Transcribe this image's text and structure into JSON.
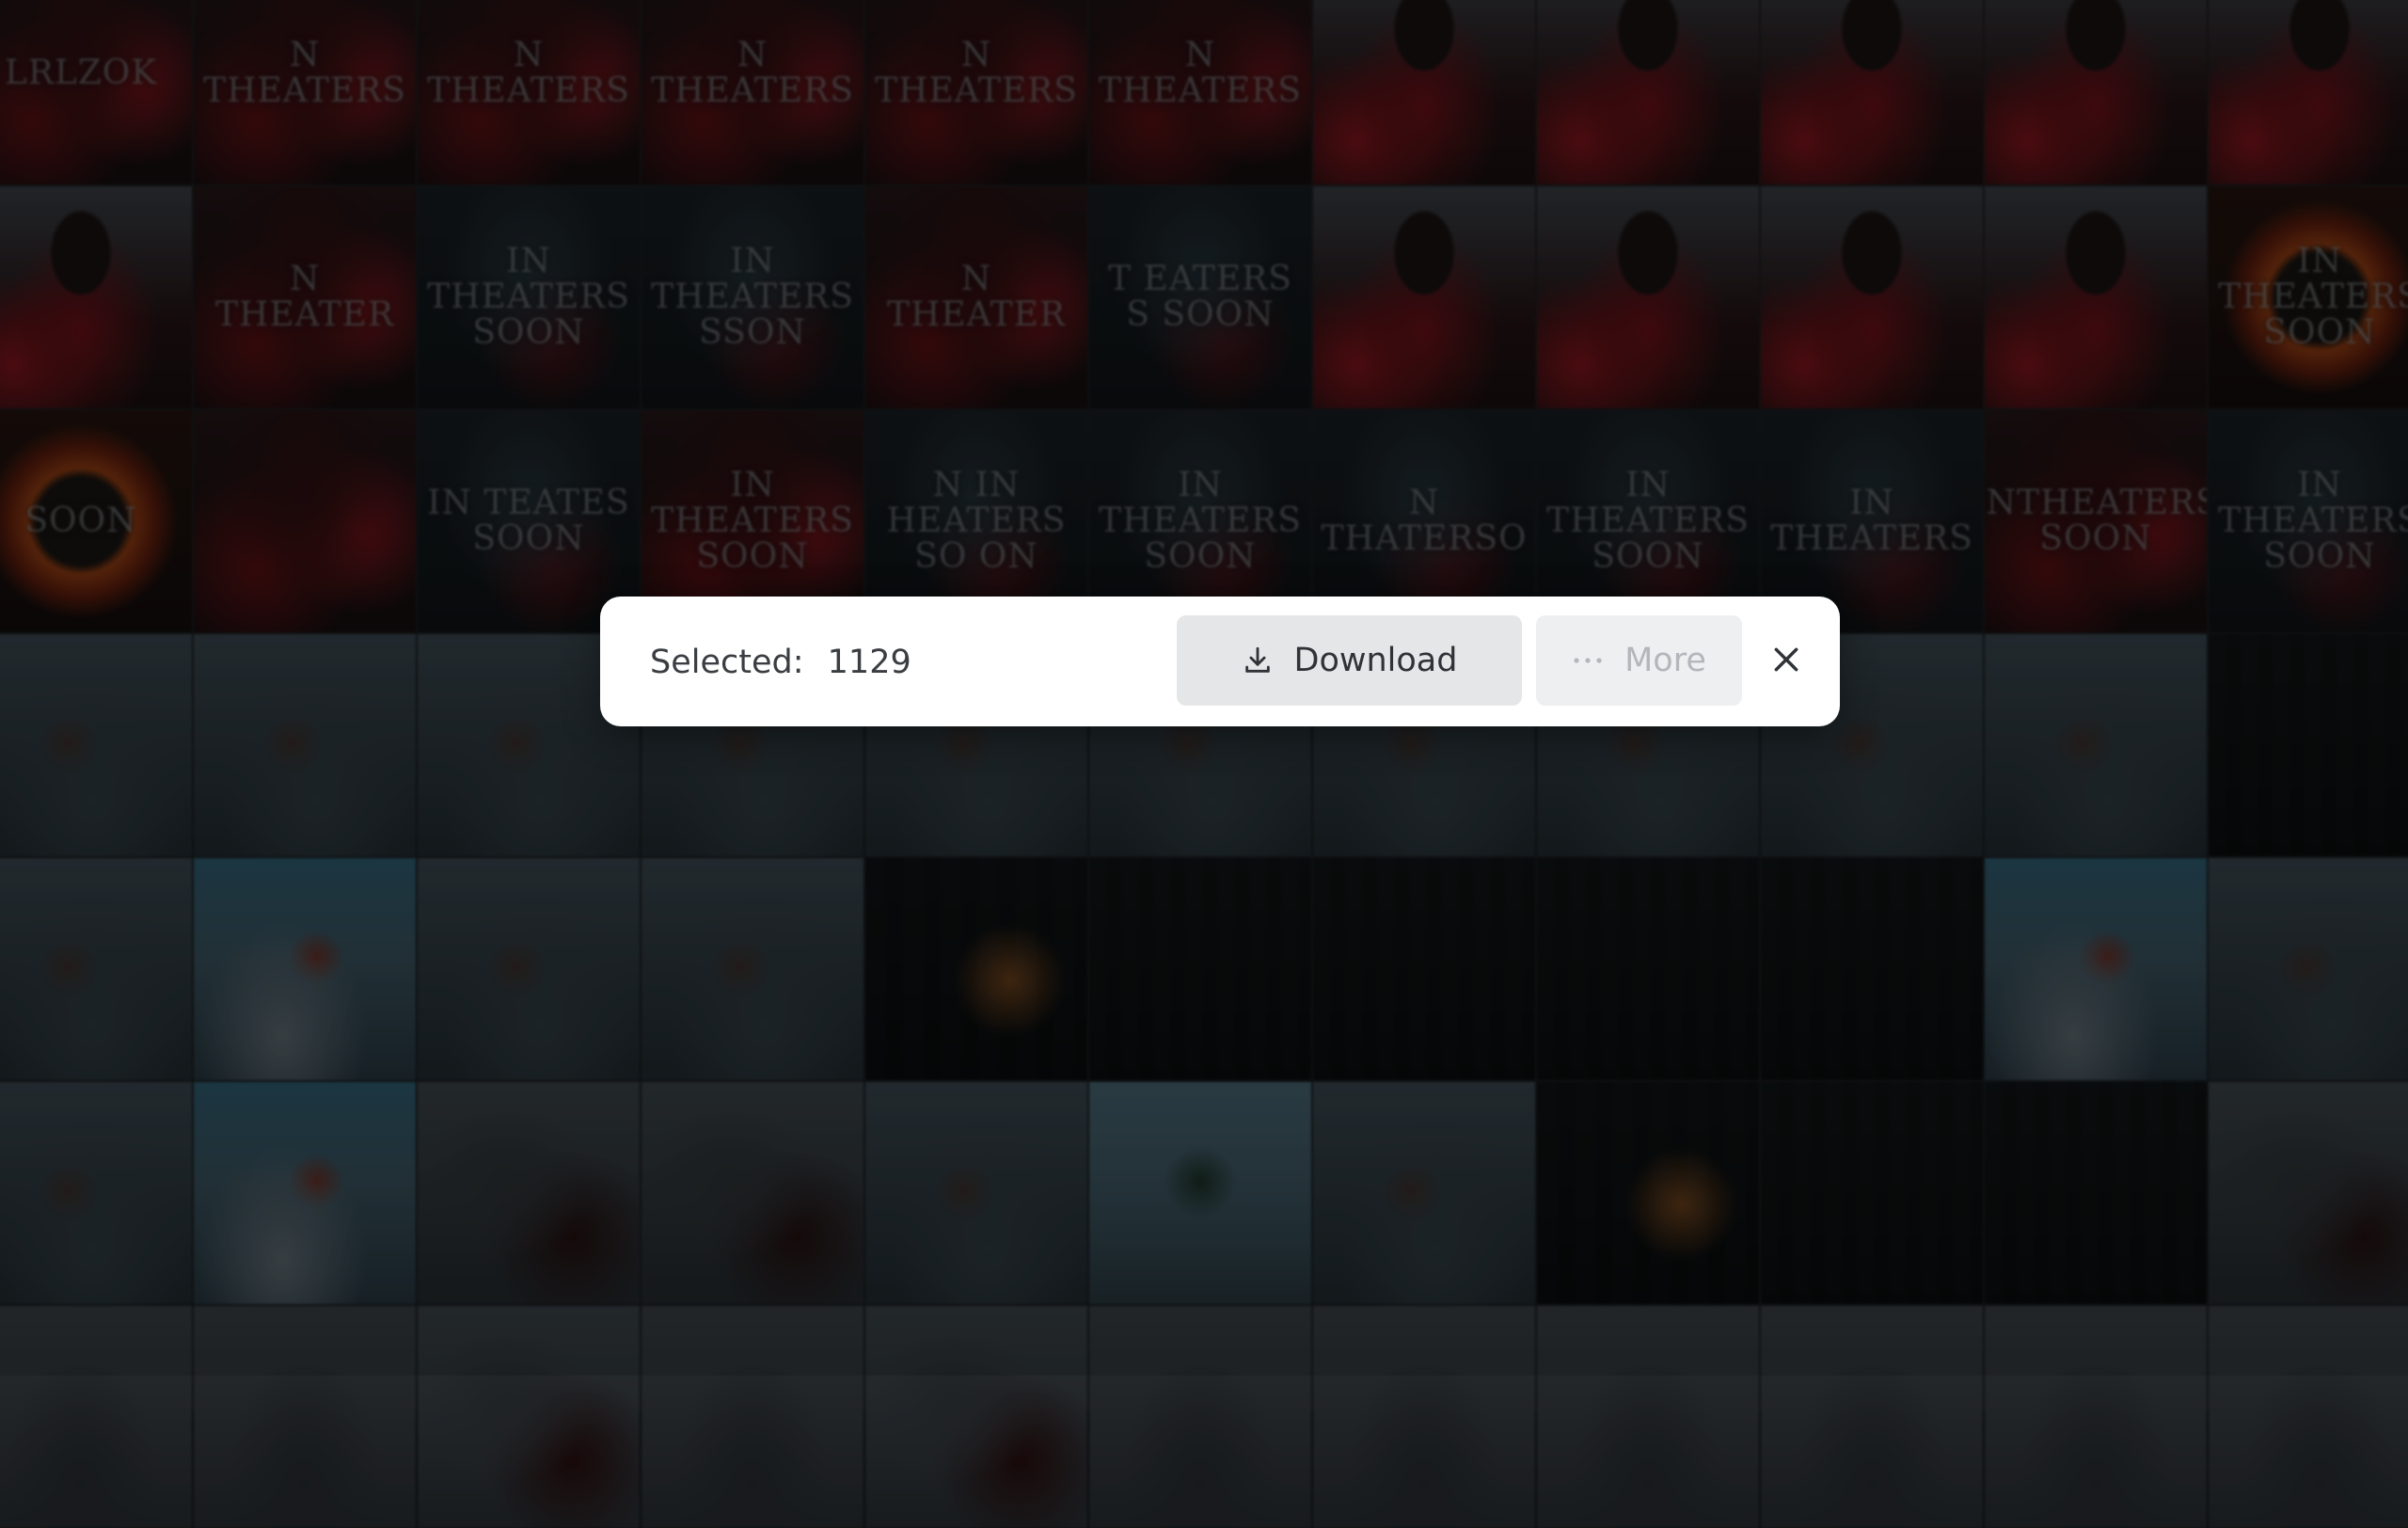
{
  "gallery": {
    "rows": [
      {
        "tiles": [
          {
            "style": "t-red",
            "text": "LRLZOK"
          },
          {
            "style": "t-red",
            "text": "N THEATERS"
          },
          {
            "style": "t-red",
            "text": "N THEATERS"
          },
          {
            "style": "t-red",
            "text": "N THEATERS"
          },
          {
            "style": "t-red",
            "text": "N THEATERS"
          },
          {
            "style": "t-red",
            "text": "N THEATERS"
          },
          {
            "style": "t-hood",
            "text": ""
          },
          {
            "style": "t-hood",
            "text": ""
          },
          {
            "style": "t-hood",
            "text": ""
          },
          {
            "style": "t-hood",
            "text": ""
          },
          {
            "style": "t-hood",
            "text": ""
          }
        ]
      },
      {
        "tiles": [
          {
            "style": "t-hood",
            "text": ""
          },
          {
            "style": "t-red",
            "text": "N THEATER"
          },
          {
            "style": "t-dark",
            "text": "IN THEATERS SOON"
          },
          {
            "style": "t-dark",
            "text": "IN THEATERS SSON"
          },
          {
            "style": "t-red",
            "text": "N THEATER"
          },
          {
            "style": "t-dark",
            "text": "T EATERS S SOON"
          },
          {
            "style": "t-hood",
            "text": ""
          },
          {
            "style": "t-hood",
            "text": ""
          },
          {
            "style": "t-hood",
            "text": ""
          },
          {
            "style": "t-hood",
            "text": ""
          },
          {
            "style": "t-fire",
            "text": "IN THEATERS SOON"
          }
        ]
      },
      {
        "tiles": [
          {
            "style": "t-fire",
            "text": "SOON"
          },
          {
            "style": "t-red",
            "text": ""
          },
          {
            "style": "t-dark",
            "text": "IN TEATES SOON"
          },
          {
            "style": "t-red",
            "text": "IN THEATERS SOON"
          },
          {
            "style": "t-dark",
            "text": "N IN HEATERS SO ON"
          },
          {
            "style": "t-dark",
            "text": "IN THEATERS SOON"
          },
          {
            "style": "t-dark",
            "text": "N THATERSO"
          },
          {
            "style": "t-dark",
            "text": "IN THEATERS SOON"
          },
          {
            "style": "t-dark",
            "text": "IN THEATERS"
          },
          {
            "style": "t-red",
            "text": "INTHEATERS SOON"
          },
          {
            "style": "t-dark",
            "text": "IN THEATERS SOON"
          }
        ]
      },
      {
        "tiles": [
          {
            "style": "t-sky",
            "text": ""
          },
          {
            "style": "t-sky",
            "text": ""
          },
          {
            "style": "t-sky",
            "text": ""
          },
          {
            "style": "t-sky",
            "text": ""
          },
          {
            "style": "t-sky",
            "text": ""
          },
          {
            "style": "t-sky",
            "text": ""
          },
          {
            "style": "t-sky",
            "text": ""
          },
          {
            "style": "t-sky",
            "text": ""
          },
          {
            "style": "t-sky",
            "text": ""
          },
          {
            "style": "t-sky",
            "text": ""
          },
          {
            "style": "t-city",
            "text": ""
          }
        ]
      },
      {
        "tiles": [
          {
            "style": "t-sky",
            "text": ""
          },
          {
            "style": "t-sky2",
            "text": ""
          },
          {
            "style": "t-sky",
            "text": ""
          },
          {
            "style": "t-sky",
            "text": ""
          },
          {
            "style": "t-cityfire",
            "text": ""
          },
          {
            "style": "t-city",
            "text": ""
          },
          {
            "style": "t-city",
            "text": ""
          },
          {
            "style": "t-city",
            "text": ""
          },
          {
            "style": "t-city",
            "text": ""
          },
          {
            "style": "t-sky2",
            "text": ""
          },
          {
            "style": "t-sky",
            "text": ""
          }
        ]
      },
      {
        "tiles": [
          {
            "style": "t-sky",
            "text": ""
          },
          {
            "style": "t-sky2",
            "text": ""
          },
          {
            "style": "t-drag",
            "text": ""
          },
          {
            "style": "t-drag",
            "text": ""
          },
          {
            "style": "t-sky",
            "text": ""
          },
          {
            "style": "t-teal",
            "text": ""
          },
          {
            "style": "t-sky",
            "text": ""
          },
          {
            "style": "t-cityfire",
            "text": ""
          },
          {
            "style": "t-city",
            "text": ""
          },
          {
            "style": "t-city",
            "text": ""
          },
          {
            "style": "t-drag",
            "text": ""
          }
        ]
      },
      {
        "tiles": [
          {
            "style": "t-bottom",
            "text": ""
          },
          {
            "style": "t-bottom",
            "text": ""
          },
          {
            "style": "t-drag",
            "text": ""
          },
          {
            "style": "t-bottom",
            "text": ""
          },
          {
            "style": "t-drag",
            "text": ""
          },
          {
            "style": "t-bottom",
            "text": ""
          },
          {
            "style": "t-bottom",
            "text": ""
          },
          {
            "style": "t-bottom",
            "text": ""
          },
          {
            "style": "t-bottom",
            "text": ""
          },
          {
            "style": "t-bottom",
            "text": ""
          },
          {
            "style": "t-bottom",
            "text": ""
          }
        ]
      }
    ]
  },
  "selection_bar": {
    "label": "Selected:",
    "count": "1129",
    "download_label": "Download",
    "download_icon": "download-icon",
    "more_label": "More",
    "more_icon": "ellipsis-icon",
    "close_icon": "close-icon"
  },
  "colors": {
    "bar_background": "#ffffff",
    "download_button_bg": "#e5e6e8",
    "more_button_bg": "#eeeff1",
    "more_text_disabled": "#b3b6ba",
    "text_primary": "#3a3d42"
  }
}
